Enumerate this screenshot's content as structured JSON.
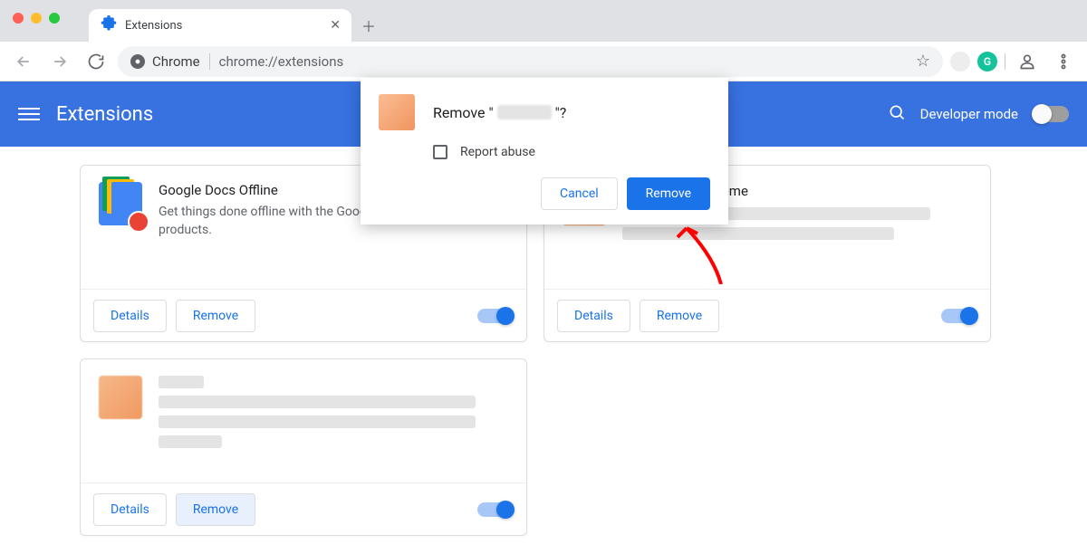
{
  "window": {
    "tab_title": "Extensions"
  },
  "toolbar": {
    "omnibox_label": "Chrome",
    "omnibox_url": "chrome://extensions"
  },
  "header": {
    "title": "Extensions",
    "dev_mode_label": "Developer mode"
  },
  "cards": [
    {
      "name": "Google Docs Offline",
      "desc": "Get things done offline with the Google Docs family of products.",
      "details": "Details",
      "remove": "Remove"
    },
    {
      "name_suffix": " for Chrome",
      "details": "Details",
      "remove": "Remove"
    },
    {
      "details": "Details",
      "remove": "Remove"
    }
  ],
  "dialog": {
    "title_prefix": "Remove \"",
    "title_suffix": "\"?",
    "checkbox_label": "Report abuse",
    "cancel": "Cancel",
    "remove": "Remove"
  }
}
